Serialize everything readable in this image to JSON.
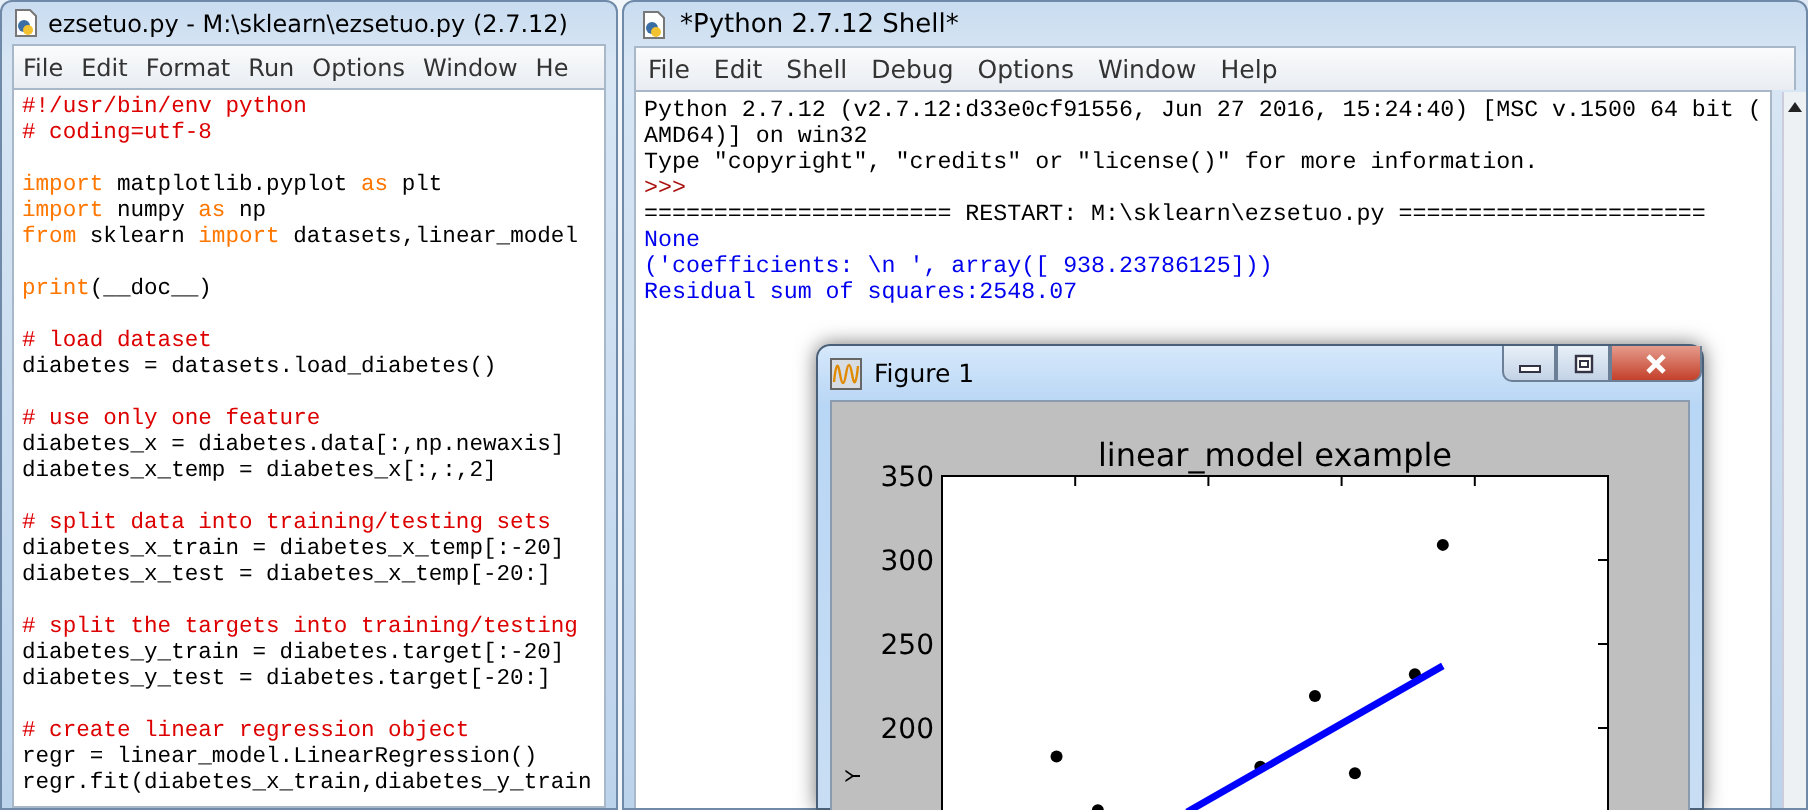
{
  "editor": {
    "title": "ezsetuo.py - M:\\sklearn\\ezsetuo.py (2.7.12)",
    "menu": [
      "File",
      "Edit",
      "Format",
      "Run",
      "Options",
      "Window",
      "He"
    ],
    "lines": [
      {
        "kind": "code",
        "segments": [
          {
            "kind": "comment",
            "text": "#!/usr/bin/env python"
          }
        ]
      },
      {
        "kind": "code",
        "segments": [
          {
            "kind": "comment",
            "text": "# coding=utf-8"
          }
        ]
      },
      {
        "kind": "blank"
      },
      {
        "kind": "code",
        "segments": [
          {
            "kind": "keyword",
            "text": "import"
          },
          {
            "kind": "plain",
            "text": " matplotlib.pyplot "
          },
          {
            "kind": "keyword",
            "text": "as"
          },
          {
            "kind": "plain",
            "text": " plt"
          }
        ]
      },
      {
        "kind": "code",
        "segments": [
          {
            "kind": "keyword",
            "text": "import"
          },
          {
            "kind": "plain",
            "text": " numpy "
          },
          {
            "kind": "keyword",
            "text": "as"
          },
          {
            "kind": "plain",
            "text": " np"
          }
        ]
      },
      {
        "kind": "code",
        "segments": [
          {
            "kind": "keyword",
            "text": "from"
          },
          {
            "kind": "plain",
            "text": " sklearn "
          },
          {
            "kind": "keyword",
            "text": "import"
          },
          {
            "kind": "plain",
            "text": " datasets,linear_model"
          }
        ]
      },
      {
        "kind": "blank"
      },
      {
        "kind": "code",
        "segments": [
          {
            "kind": "keyword",
            "text": "print"
          },
          {
            "kind": "plain",
            "text": "(__doc__)"
          }
        ]
      },
      {
        "kind": "blank"
      },
      {
        "kind": "code",
        "segments": [
          {
            "kind": "comment",
            "text": "# load dataset"
          }
        ]
      },
      {
        "kind": "code",
        "segments": [
          {
            "kind": "plain",
            "text": "diabetes = datasets.load_diabetes()"
          }
        ]
      },
      {
        "kind": "blank"
      },
      {
        "kind": "code",
        "segments": [
          {
            "kind": "comment",
            "text": "# use only one feature"
          }
        ]
      },
      {
        "kind": "code",
        "segments": [
          {
            "kind": "plain",
            "text": "diabetes_x = diabetes.data[:,np.newaxis]"
          }
        ]
      },
      {
        "kind": "code",
        "segments": [
          {
            "kind": "plain",
            "text": "diabetes_x_temp = diabetes_x[:,:,2]"
          }
        ]
      },
      {
        "kind": "blank"
      },
      {
        "kind": "code",
        "segments": [
          {
            "kind": "comment",
            "text": "# split data into training/testing sets"
          }
        ]
      },
      {
        "kind": "code",
        "segments": [
          {
            "kind": "plain",
            "text": "diabetes_x_train = diabetes_x_temp[:-20]"
          }
        ]
      },
      {
        "kind": "code",
        "segments": [
          {
            "kind": "plain",
            "text": "diabetes_x_test = diabetes_x_temp[-20:]"
          }
        ]
      },
      {
        "kind": "blank"
      },
      {
        "kind": "code",
        "segments": [
          {
            "kind": "comment",
            "text": "# split the targets into training/testing"
          }
        ]
      },
      {
        "kind": "code",
        "segments": [
          {
            "kind": "plain",
            "text": "diabetes_y_train = diabetes.target[:-20]"
          }
        ]
      },
      {
        "kind": "code",
        "segments": [
          {
            "kind": "plain",
            "text": "diabetes_y_test = diabetes.target[-20:]"
          }
        ]
      },
      {
        "kind": "blank"
      },
      {
        "kind": "code",
        "segments": [
          {
            "kind": "comment",
            "text": "# create linear regression object"
          }
        ]
      },
      {
        "kind": "code",
        "segments": [
          {
            "kind": "plain",
            "text": "regr = linear_model.LinearRegression()"
          }
        ]
      },
      {
        "kind": "code",
        "segments": [
          {
            "kind": "plain",
            "text": "regr.fit(diabetes_x_train,diabetes_y_train"
          }
        ]
      }
    ]
  },
  "shell": {
    "title": "*Python 2.7.12 Shell*",
    "menu": [
      "File",
      "Edit",
      "Shell",
      "Debug",
      "Options",
      "Window",
      "Help"
    ],
    "lines": [
      {
        "kind": "info",
        "text": "Python 2.7.12 (v2.7.12:d33e0cf91556, Jun 27 2016, 15:24:40) [MSC v.1500 64 bit ("
      },
      {
        "kind": "info",
        "text": "AMD64)] on win32"
      },
      {
        "kind": "info",
        "text": "Type \"copyright\", \"credits\" or \"license()\" for more information."
      },
      {
        "kind": "prompt",
        "text": ">>>"
      },
      {
        "kind": "info",
        "text": "====================== RESTART: M:\\sklearn\\ezsetuo.py ======================"
      },
      {
        "kind": "stdout",
        "text": "None"
      },
      {
        "kind": "stdout",
        "text": "('coefficients: \\n ', array([ 938.23786125]))"
      },
      {
        "kind": "stdout",
        "text": "Residual sum of squares:2548.07"
      }
    ]
  },
  "figure": {
    "title": "Figure 1",
    "plot": {
      "title": "linear_model example",
      "ylabel": "Y",
      "ytick_labels": [
        "350",
        "300",
        "250",
        "200"
      ]
    }
  }
}
